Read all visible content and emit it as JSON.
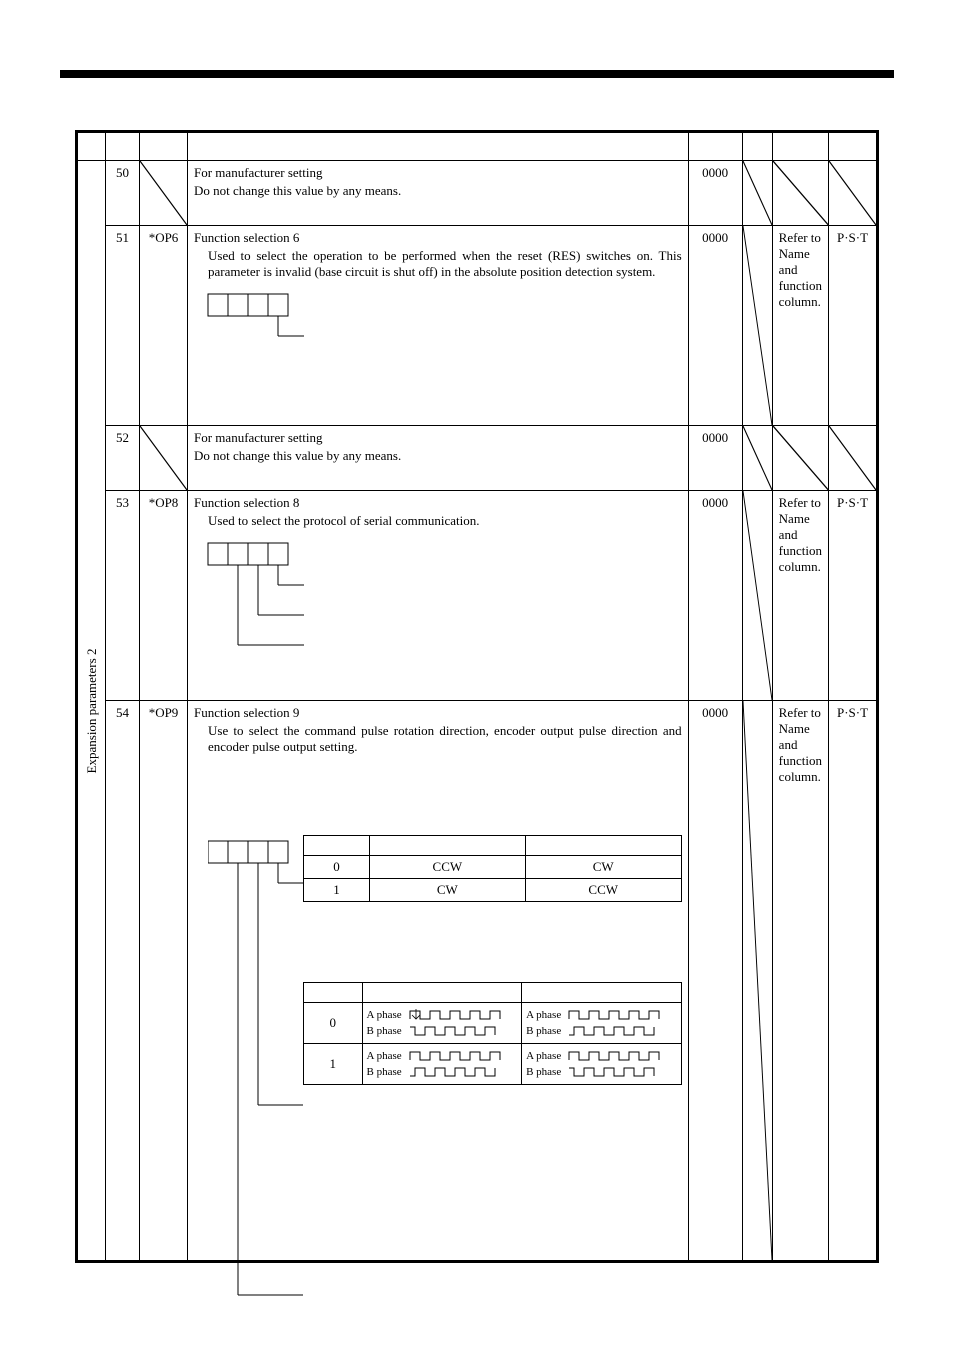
{
  "classLabel": "Expansion parameters 2",
  "rows": [
    {
      "no": "50",
      "symbol": "",
      "title": "For manufacturer setting",
      "body": "Do not change this value by any means.",
      "initial": "0000",
      "setting": "",
      "mode": "",
      "diagSetting": true,
      "diagMode": true
    },
    {
      "no": "51",
      "symbol": "*OP6",
      "title": "Function selection 6",
      "body": "Used to select the operation to be performed when the reset (RES) switches on. This parameter is invalid (base circuit is shut off) in the absolute position detection system.",
      "initial": "0000",
      "setting": "Refer to Name and function column.",
      "mode": "P·S·T",
      "diagUnit": true,
      "tree": 1
    },
    {
      "no": "52",
      "symbol": "",
      "title": "For manufacturer setting",
      "body": "Do not change this value by any means.",
      "initial": "0000",
      "setting": "",
      "mode": "",
      "diagSetting": true,
      "diagMode": true
    },
    {
      "no": "53",
      "symbol": "*OP8",
      "title": "Function selection 8",
      "body": "Used to select the protocol of serial communication.",
      "initial": "0000",
      "setting": "Refer to Name and function column.",
      "mode": "P·S·T",
      "diagUnit": true,
      "tree": 2
    },
    {
      "no": "54",
      "symbol": "*OP9",
      "title": "Function selection 9",
      "body": "Use to select the command pulse rotation direction, encoder output pulse direction and encoder pulse output setting.",
      "initial": "0000",
      "setting": "Refer to Name and function column.",
      "mode": "P·S·T",
      "diagUnit": true,
      "rotationTable": {
        "rows": [
          {
            "setting": "0",
            "fwd": "CCW",
            "rev": "CW"
          },
          {
            "setting": "1",
            "fwd": "CW",
            "rev": "CCW"
          }
        ]
      },
      "encoderTable": {
        "rows": [
          {
            "setting": "0",
            "a": "A phase",
            "b": "B phase"
          },
          {
            "setting": "1",
            "a": "A phase",
            "b": "B phase"
          }
        ]
      }
    }
  ]
}
